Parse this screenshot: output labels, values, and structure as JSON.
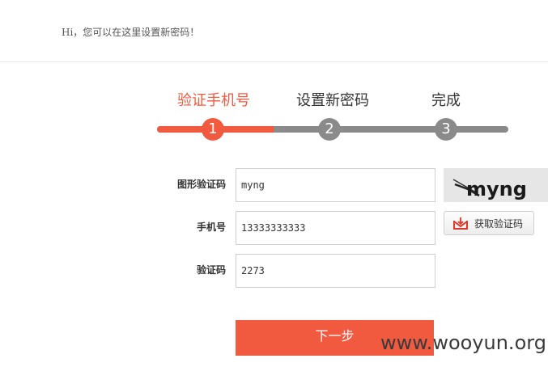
{
  "header": {
    "greeting": "Hi，您可以在这里设置新密码！"
  },
  "steps": [
    {
      "label": "验证手机号",
      "number": "1",
      "active": true
    },
    {
      "label": "设置新密码",
      "number": "2",
      "active": false
    },
    {
      "label": "完成",
      "number": "3",
      "active": false
    }
  ],
  "progress": {
    "completed_fraction": 0.33
  },
  "form": {
    "captcha": {
      "label": "图形验证码",
      "value": "myng",
      "image_text": "myng"
    },
    "phone": {
      "label": "手机号",
      "value": "13333333333"
    },
    "sms_code": {
      "label": "验证码",
      "value": "2273"
    },
    "sms_button_label": "获取验证码",
    "next_button_label": "下一步"
  },
  "watermark": "www.wooyun.org",
  "colors": {
    "accent": "#f25a40",
    "inactive": "#8a8a8a"
  }
}
